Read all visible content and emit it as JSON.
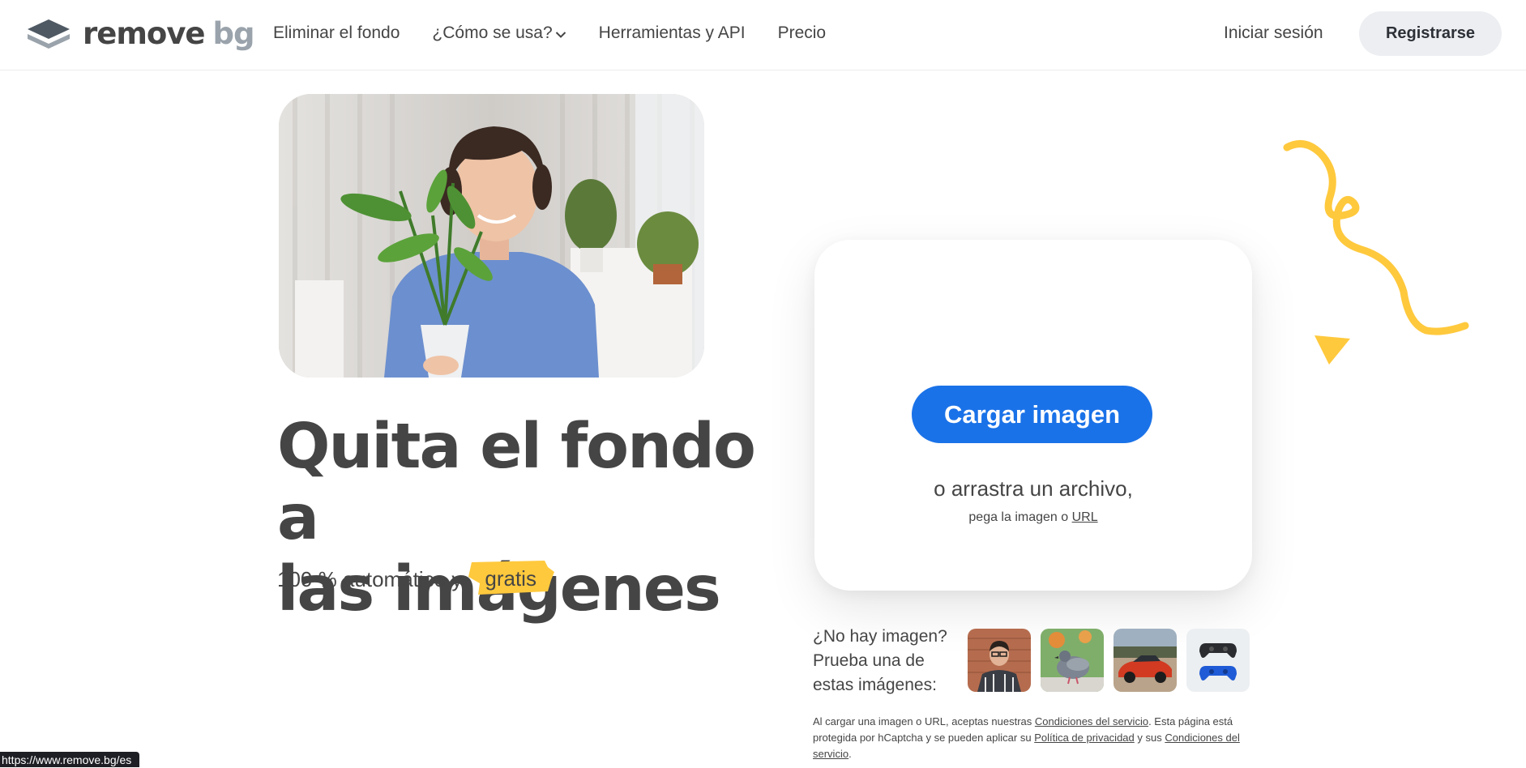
{
  "header": {
    "logo_primary": "remove",
    "logo_secondary": "bg",
    "nav": [
      {
        "label": "Eliminar el fondo"
      },
      {
        "label": "¿Cómo se usa?"
      },
      {
        "label": "Herramientas y API"
      },
      {
        "label": "Precio"
      }
    ],
    "login_label": "Iniciar sesión",
    "signup_label": "Registrarse"
  },
  "hero": {
    "title_line1": "Quita el fondo a",
    "title_line2": "las imágenes",
    "subtitle": "100 % automático y",
    "badge": "gratis"
  },
  "upload": {
    "button_label": "Cargar imagen",
    "drag_text": "o arrastra un archivo,",
    "paste_prefix": "pega la imagen o ",
    "url_link": "URL"
  },
  "samples": {
    "label_line1": "¿No hay imagen?",
    "label_line2": "Prueba una de",
    "label_line3": "estas imágenes:"
  },
  "legal": {
    "part1": "Al cargar una imagen o URL, aceptas nuestras ",
    "link1": "Condiciones del servicio",
    "part2": ". Esta página está protegida por hCaptcha y se pueden aplicar su ",
    "link2": "Política de privacidad",
    "part3": " y sus ",
    "link3": "Condiciones del servicio",
    "part4": "."
  },
  "status_bar": {
    "url": "https://www.remove.bg/es"
  },
  "colors": {
    "accent_blue": "#1a72e8",
    "badge_yellow": "#ffc93d",
    "text": "#454545"
  }
}
